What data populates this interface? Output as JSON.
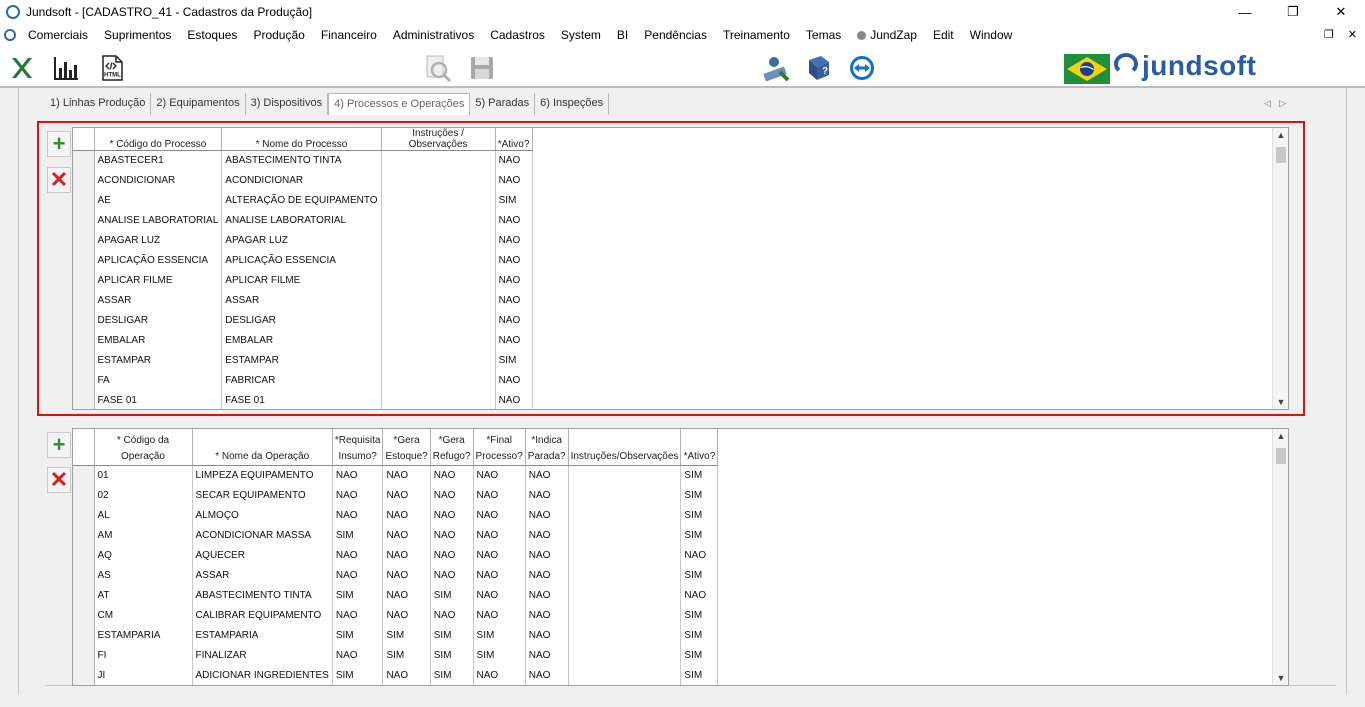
{
  "window": {
    "title": "Jundsoft - [CADASTRO_41 - Cadastros da Produção]"
  },
  "menu": {
    "items": [
      "Comerciais",
      "Suprimentos",
      "Estoques",
      "Produção",
      "Financeiro",
      "Administrativos",
      "Cadastros",
      "System",
      "BI",
      "Pendências",
      "Treinamento",
      "Temas",
      "JundZap",
      "Edit",
      "Window"
    ]
  },
  "toolbar": {
    "icons": [
      "excel-icon",
      "chart-icon",
      "html-icon",
      "zoom-icon",
      "save-icon",
      "user-icon",
      "book-icon",
      "teamviewer-icon"
    ],
    "html_label": "HTML",
    "brand": "jundsoft"
  },
  "tabs": [
    {
      "label": "1) Linhas Produção",
      "active": false
    },
    {
      "label": "2) Equipamentos",
      "active": false
    },
    {
      "label": "3) Dispositivos",
      "active": false
    },
    {
      "label": "4) Processos e Operações",
      "active": true
    },
    {
      "label": "5) Paradas",
      "active": false
    },
    {
      "label": "6) Inspeções",
      "active": false
    }
  ],
  "processes": {
    "columns": [
      "* Código do Processo",
      "* Nome do Processo",
      "Instruções / Observações",
      "*Ativo?"
    ],
    "rows": [
      [
        "ABASTECER1",
        "ABASTECIMENTO TINTA",
        "",
        "NAO"
      ],
      [
        "ACONDICIONAR",
        "ACONDICIONAR",
        "",
        "NAO"
      ],
      [
        "AE",
        "ALTERAÇÃO DE EQUIPAMENTO",
        "",
        "SIM"
      ],
      [
        "ANALISE LABORATORIAL",
        "ANALISE LABORATORIAL",
        "",
        "NAO"
      ],
      [
        "APAGAR LUZ",
        "APAGAR LUZ",
        "",
        "NAO"
      ],
      [
        "APLICAÇÃO ESSENCIA",
        "APLICAÇÃO ESSENCIA",
        "",
        "NAO"
      ],
      [
        "APLICAR FILME",
        "APLICAR FILME",
        "",
        "NAO"
      ],
      [
        "ASSAR",
        "ASSAR",
        "",
        "NAO"
      ],
      [
        "DESLIGAR",
        "DESLIGAR",
        "",
        "NAO"
      ],
      [
        "EMBALAR",
        "EMBALAR",
        "",
        "NAO"
      ],
      [
        "ESTAMPAR",
        "ESTAMPAR",
        "",
        "SIM"
      ],
      [
        "FA",
        "FABRICAR",
        "",
        "NAO"
      ],
      [
        "FASE 01",
        "FASE 01",
        "",
        "NAO"
      ]
    ]
  },
  "operations": {
    "columns": [
      [
        "",
        "* Código da Operação"
      ],
      [
        "",
        "* Nome da Operação"
      ],
      [
        "*Requisita",
        "Insumo?"
      ],
      [
        "*Gera",
        "Estoque?"
      ],
      [
        "*Gera",
        "Refugo?"
      ],
      [
        "*Final",
        "Processo?"
      ],
      [
        "*Indica",
        "Parada?"
      ],
      [
        "",
        "Instruções/Observações"
      ],
      [
        "",
        "*Ativo?"
      ]
    ],
    "rows": [
      [
        "01",
        "LIMPEZA EQUIPAMENTO",
        "NAO",
        "NAO",
        "NAO",
        "NAO",
        "NAO",
        "",
        "SIM"
      ],
      [
        "02",
        "SECAR EQUIPAMENTO",
        "NAO",
        "NAO",
        "NAO",
        "NAO",
        "NAO",
        "",
        "SIM"
      ],
      [
        "AL",
        "ALMOÇO",
        "NAO",
        "NAO",
        "NAO",
        "NAO",
        "NAO",
        "",
        "SIM"
      ],
      [
        "AM",
        "ACONDICIONAR MASSA",
        "SIM",
        "NAO",
        "NAO",
        "NAO",
        "NAO",
        "",
        "SIM"
      ],
      [
        "AQ",
        "AQUECER",
        "NAO",
        "NAO",
        "NAO",
        "NAO",
        "NAO",
        "",
        "NAO"
      ],
      [
        "AS",
        "ASSAR",
        "NAO",
        "NAO",
        "NAO",
        "NAO",
        "NAO",
        "",
        "SIM"
      ],
      [
        "AT",
        "ABASTECIMENTO TINTA",
        "SIM",
        "NAO",
        "SIM",
        "NAO",
        "NAO",
        "",
        "NAO"
      ],
      [
        "CM",
        "CALIBRAR EQUIPAMENTO",
        "NAO",
        "NAO",
        "NAO",
        "NAO",
        "NAO",
        "",
        "SIM"
      ],
      [
        "ESTAMPARIA",
        "ESTAMPARIA",
        "SIM",
        "SIM",
        "SIM",
        "SIM",
        "NAO",
        "",
        "SIM"
      ],
      [
        "FI",
        "FINALIZAR",
        "NAO",
        "SIM",
        "SIM",
        "SIM",
        "NAO",
        "",
        "SIM"
      ],
      [
        "JI",
        "ADICIONAR INGREDIENTES",
        "SIM",
        "NAO",
        "SIM",
        "NAO",
        "NAO",
        "",
        "SIM"
      ]
    ]
  }
}
